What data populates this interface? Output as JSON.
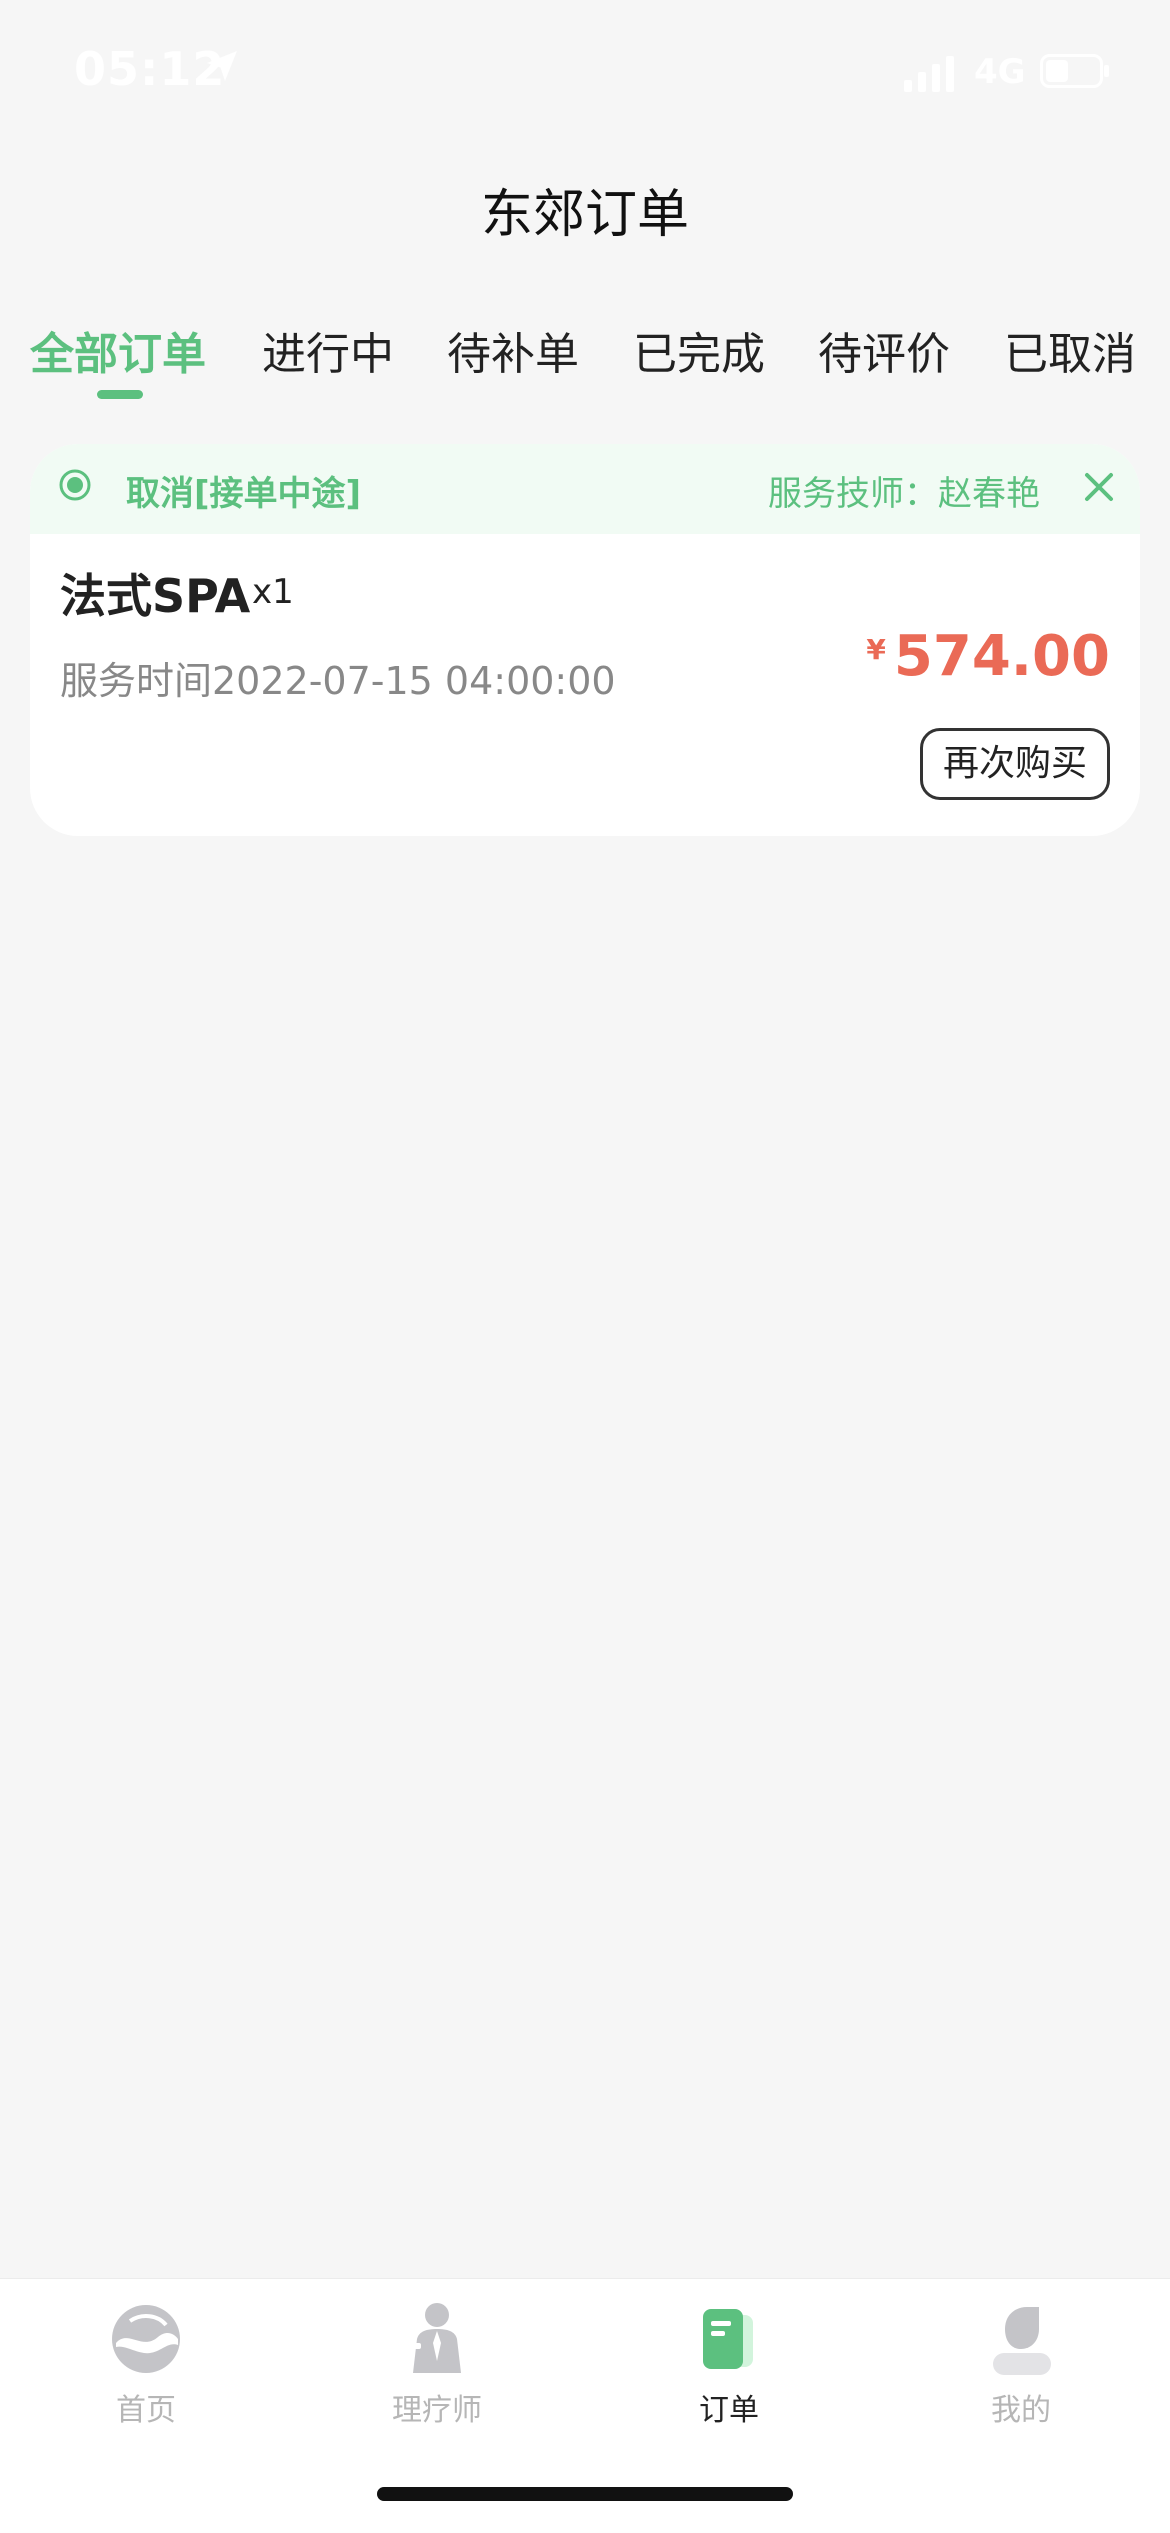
{
  "status_bar": {
    "time": "05:12",
    "network": "4G"
  },
  "header": {
    "title": "东郊订单"
  },
  "tabs": [
    {
      "label": "全部订单",
      "active": true
    },
    {
      "label": "进行中"
    },
    {
      "label": "待补单"
    },
    {
      "label": "已完成"
    },
    {
      "label": "待评价"
    },
    {
      "label": "已取消"
    }
  ],
  "order": {
    "status": "取消[接单中途]",
    "technician": "服务技师：赵春艳",
    "product_name": "法式SPA",
    "quantity": "x1",
    "service_time": "服务时间2022-07-15 04:00:00",
    "currency": "¥",
    "price": "574.00",
    "rebuy_label": "再次购买"
  },
  "bottom_nav": {
    "items": [
      {
        "label": "首页",
        "icon": "home-icon"
      },
      {
        "label": "理疗师",
        "icon": "therapist-icon"
      },
      {
        "label": "订单",
        "icon": "order-icon",
        "active": true
      },
      {
        "label": "我的",
        "icon": "profile-icon"
      }
    ]
  },
  "colors": {
    "accent": "#5cc07f",
    "price": "#ea6a56",
    "background": "#f6f6f6"
  }
}
